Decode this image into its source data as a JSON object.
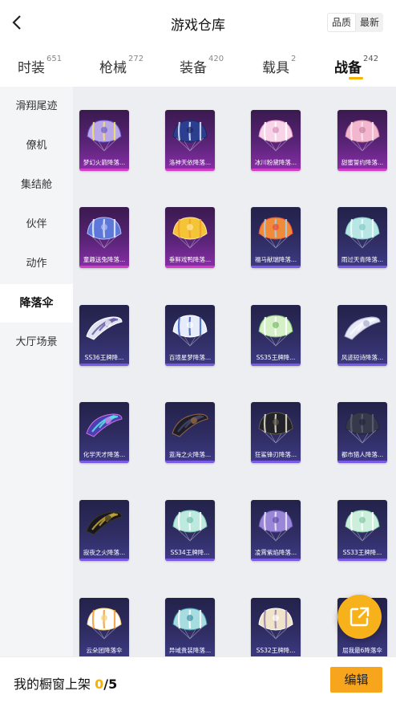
{
  "header": {
    "title": "游戏仓库",
    "sort_options": [
      "品质",
      "最新"
    ],
    "sort_active": 0
  },
  "tabs": [
    {
      "label": "时装",
      "count": "651"
    },
    {
      "label": "枪械",
      "count": "272"
    },
    {
      "label": "装备",
      "count": "420"
    },
    {
      "label": "载具",
      "count": "2"
    },
    {
      "label": "战备",
      "count": "242",
      "active": true
    }
  ],
  "sidebar": {
    "items": [
      "滑翔尾迹",
      "僚机",
      "集结舱",
      "伙伴",
      "动作",
      "降落伞",
      "大厅场景"
    ],
    "active_index": 5
  },
  "items": [
    {
      "name": "梦幻火箭降落...",
      "rarity": "pink",
      "art": "purple-star"
    },
    {
      "name": "洛神天依降落...",
      "rarity": "pink",
      "art": "navy-blue"
    },
    {
      "name": "冰川粉黛降落...",
      "rarity": "pink",
      "art": "pink-white"
    },
    {
      "name": "甜蜜誓约降落...",
      "rarity": "pink",
      "art": "pink-lace"
    },
    {
      "name": "童趣送兔降落...",
      "rarity": "pink",
      "art": "rabbit-blue"
    },
    {
      "name": "垂鲜戏鸭降落...",
      "rarity": "pink",
      "art": "yellow-duck"
    },
    {
      "name": "福马献瑞降落...",
      "rarity": "purple",
      "art": "orange-horse"
    },
    {
      "name": "雨过天青降落...",
      "rarity": "purple",
      "art": "cyan-cloud"
    },
    {
      "name": "SS36王牌降...",
      "rarity": "purple",
      "art": "white-stripe"
    },
    {
      "name": "百境星梦降落...",
      "rarity": "purple",
      "art": "blue-white"
    },
    {
      "name": "SS35王牌降...",
      "rarity": "purple",
      "art": "green-white"
    },
    {
      "name": "风迹短诗降落...",
      "rarity": "purple",
      "art": "light-wing"
    },
    {
      "name": "化学天才降落...",
      "rarity": "purple",
      "art": "neon-wing"
    },
    {
      "name": "蓝海之火降落...",
      "rarity": "purple",
      "art": "dark-wing"
    },
    {
      "name": "狂鲨锋刃降落...",
      "rarity": "purple",
      "art": "black-shark"
    },
    {
      "name": "都市猎人降落...",
      "rarity": "purple",
      "art": "dark-grey"
    },
    {
      "name": "寂夜之火降落...",
      "rarity": "purple",
      "art": "black-gold"
    },
    {
      "name": "SS34王牌降...",
      "rarity": "purple",
      "art": "mint-lace"
    },
    {
      "name": "凌霄紫焰降落...",
      "rarity": "purple",
      "art": "violet-flame"
    },
    {
      "name": "SS33王牌降...",
      "rarity": "purple",
      "art": "mint-white"
    },
    {
      "name": "云朵团降落伞",
      "rarity": "purple",
      "art": "orange-cloud"
    },
    {
      "name": "异域贵装降落...",
      "rarity": "purple",
      "art": "teal-pattern"
    },
    {
      "name": "SS32王牌降...",
      "rarity": "purple",
      "art": "beige-stripe"
    },
    {
      "name": "屈我最6降落伞",
      "rarity": "purple",
      "art": "pink-blue"
    }
  ],
  "rarity_colors": {
    "pink": "#d23cc8",
    "purple": "#7a5ae6"
  },
  "footer": {
    "label": "我的橱窗上架",
    "current": "0",
    "separator_total": "/5",
    "edit_label": "编辑"
  },
  "icons": {
    "back": "chevron-left-icon",
    "share": "share-external-icon"
  },
  "accent": "#f5b400"
}
